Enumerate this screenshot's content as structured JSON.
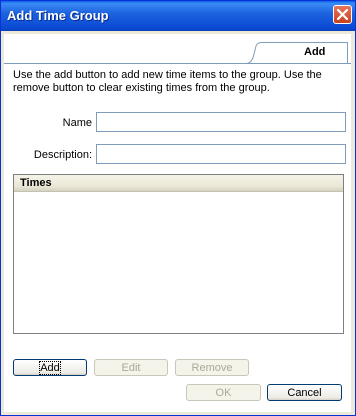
{
  "window": {
    "title": "Add Time Group",
    "close_icon": "close-icon"
  },
  "tab": {
    "label": "Add"
  },
  "instructions": "Use the add button to add new time items to the group.  Use the remove button to clear existing times from the group.",
  "form": {
    "name_label": "Name",
    "name_value": "",
    "description_label": "Description:",
    "description_value": ""
  },
  "times": {
    "header": "Times",
    "items": []
  },
  "buttons": {
    "add": "Add",
    "edit": "Edit",
    "remove": "Remove",
    "ok": "OK",
    "cancel": "Cancel"
  },
  "colors": {
    "titlebar": "#0b4ad3",
    "close": "#c8401f",
    "dialog_face": "#ece9d8",
    "field_border": "#7f9db9"
  }
}
